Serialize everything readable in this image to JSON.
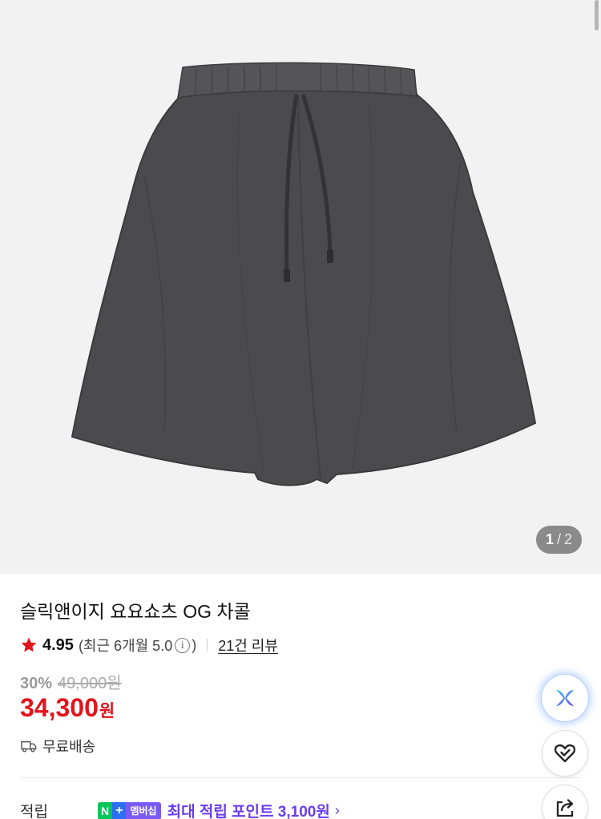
{
  "gallery": {
    "current": "1",
    "separator": "/",
    "total": "2",
    "image_subject": "shorts"
  },
  "product": {
    "title": "슬릭앤이지 요요쇼츠 OG 차콜",
    "rating": "4.95",
    "recent_rating": "(최근 6개월 5.0",
    "recent_rating_close": ")",
    "info_symbol": "i",
    "review_link": "21건 리뷰",
    "discount_rate": "30%",
    "original_price": "49,000원",
    "price": "34,300",
    "price_unit": "원",
    "shipping": "무료배송"
  },
  "points": {
    "label": "적립",
    "badge_n": "N",
    "badge_plus": "+",
    "badge_member": "멤버십",
    "text": "최대 적립 포인트 3,100원",
    "chevron": "›"
  },
  "floating": {
    "ai_icon": "ai-sparkle-icon",
    "heart_icon": "heart-check-icon",
    "share_icon": "share-icon"
  },
  "colors": {
    "price_red": "#e2141d",
    "star_red": "#e2141d",
    "points_purple": "#6a3cf0",
    "naver_green": "#03c75a",
    "image_bg": "#f2f2f2"
  }
}
